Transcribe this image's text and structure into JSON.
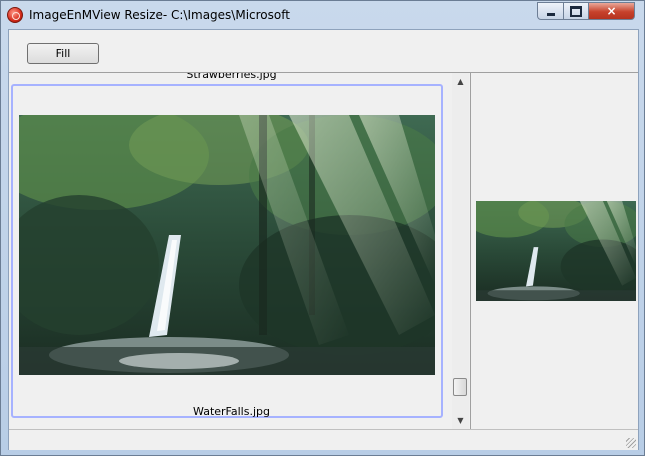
{
  "window": {
    "title": "ImageEnMView Resize- C:\\Images\\Microsoft",
    "controls": {
      "minimize": "minimize-button",
      "maximize": "maximize-button",
      "close": "×"
    }
  },
  "toolbar": {
    "fill_label": "Fill"
  },
  "multiview": {
    "items": [
      {
        "caption": "Strawberries.jpg"
      },
      {
        "caption": "WaterFalls.jpg",
        "selected": true
      }
    ]
  },
  "colors": {
    "selection_border": "#a6b2ff",
    "window_frame": "#b8cde6",
    "close_button": "#c7422c"
  },
  "icons": [
    "app-icon",
    "minimize-icon",
    "maximize-icon",
    "close-icon",
    "scroll-up-icon",
    "scroll-down-icon",
    "resize-grip-icon"
  ]
}
